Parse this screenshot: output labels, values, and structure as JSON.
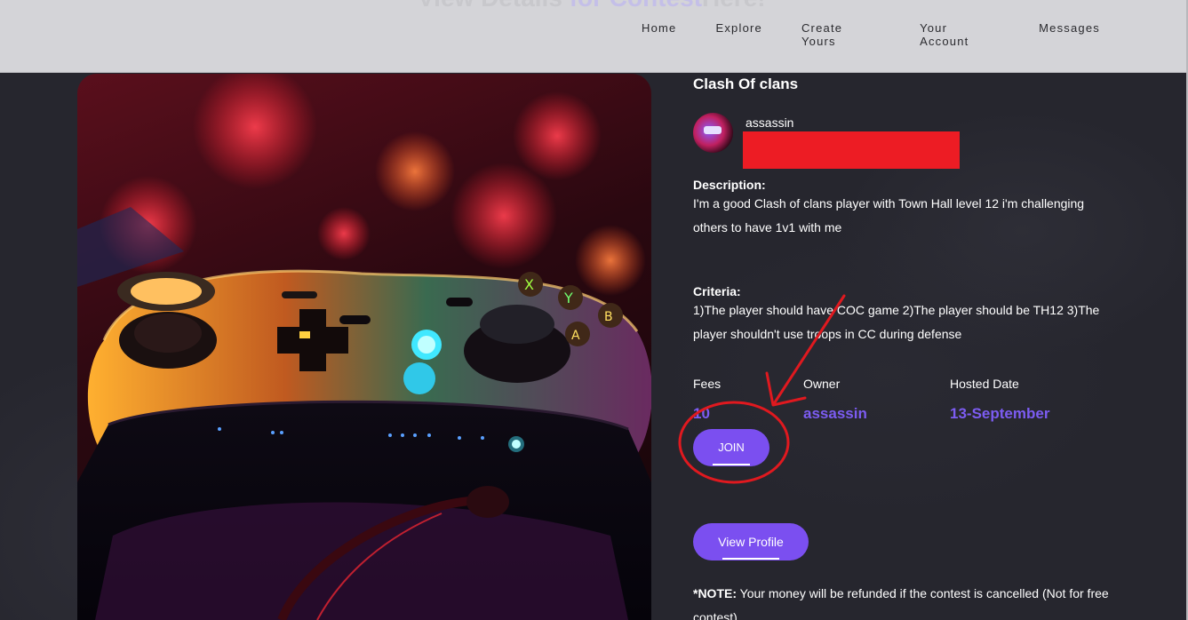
{
  "header": {
    "ghost_title_plain": "View Details ",
    "ghost_title_accent": "for Contest",
    "ghost_title_tail": "Here!",
    "nav": [
      "Home",
      "Explore",
      "Create Yours",
      "Your Account",
      "Messages"
    ]
  },
  "contest": {
    "title": "Clash Of clans",
    "author": "assassin",
    "description_label": "Description:",
    "description": "I'm a good Clash of clans player with Town Hall level 12 i'm challenging others to have 1v1 with me",
    "criteria_label": "Criteria:",
    "criteria": "1)The player should have COC game 2)The player should be TH12 3)The player shouldn't use troops in CC during defense",
    "stats": {
      "fees_label": "Fees",
      "fees_value": "10",
      "owner_label": "Owner",
      "owner_value": "assassin",
      "date_label": "Hosted Date",
      "date_value": "13-September"
    },
    "join_label": "JOIN",
    "view_profile_label": "View Profile",
    "note_prefix": "*NOTE:",
    "note_text": " Your money will be refunded if the contest is cancelled (Not for free contest)"
  },
  "colors": {
    "accent": "#7b4ff0",
    "value_text": "#7c5cf2",
    "header_bg": "#d4d4d8",
    "page_bg": "#26262e",
    "redaction": "#ed1c24",
    "annotation": "#e0191f"
  },
  "icons": {
    "hero": "game-controller-image",
    "avatar": "user-avatar"
  }
}
